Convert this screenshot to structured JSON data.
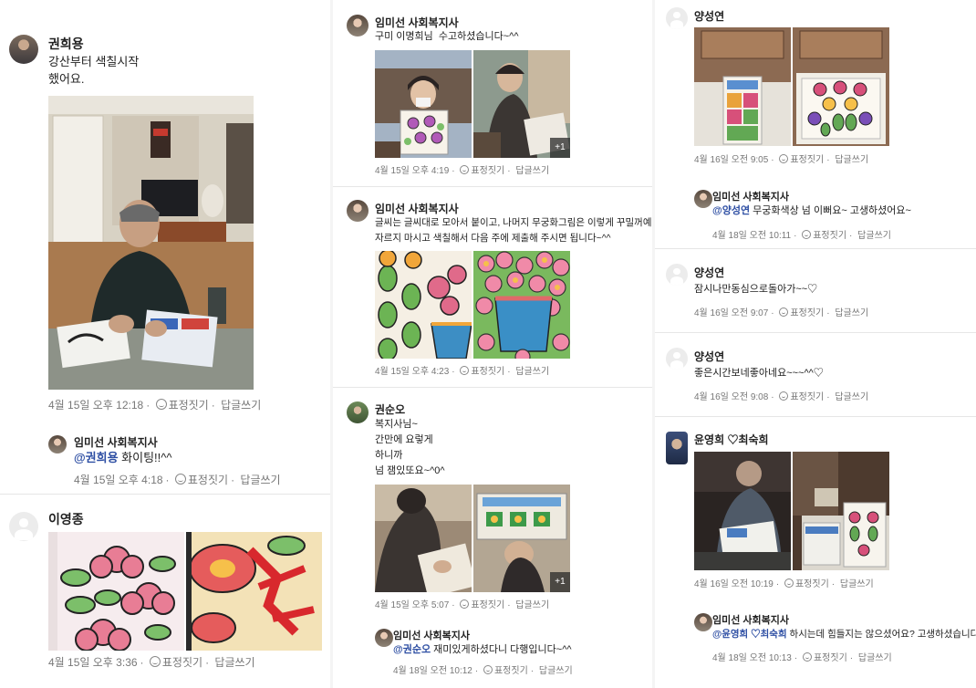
{
  "labels": {
    "react": "표정짓기",
    "reply": "답글쓰기",
    "more": "+1",
    "sep": "·"
  },
  "col1": {
    "post1": {
      "author": "권희용",
      "text": "강산부터 색칠시작\n했어요.",
      "time": "4월 15일 오후 12:18",
      "reply": {
        "author": "임미선 사회복지사",
        "mention": "@권희용",
        "text": " 화이팅!!^^",
        "time": "4월 15일 오후 4:18"
      }
    },
    "post2": {
      "author": "이영종",
      "time": "4월 15일 오후 3:36"
    }
  },
  "col2": {
    "post1": {
      "author": "임미선 사회복지사",
      "text": "구미 이명희님  수고하셨습니다~^^",
      "time": "4월 15일 오후 4:19"
    },
    "post2": {
      "author": "임미선 사회복지사",
      "text": "글씨는 글씨대로 모아서 붙이고, 나머지 무궁화그림은 이렇게 꾸밀꺼예요~\n자르지 마시고 색칠해서 다음 주에 제출해 주시면 됩니다~^^",
      "time": "4월 15일 오후 4:23"
    },
    "post3": {
      "author": "권순오",
      "text": "복지사님~\n간만에 요렇게\n하니까\n넘 잼있또요~^0^",
      "time": "4월 15일 오후 5:07",
      "reply": {
        "author": "임미선 사회복지사",
        "mention": "@권순오",
        "text": " 재미있게하셨다니 다행입니다~^^",
        "time": "4월 18일 오전 10:12"
      }
    }
  },
  "col3": {
    "post1": {
      "author": "양성연",
      "time": "4월 16일 오전 9:05",
      "reply": {
        "author": "임미선 사회복지사",
        "mention": "@양성연",
        "text": " 무궁화색상 넘 이뻐요~ 고생하셨어요~",
        "time": "4월 18일 오전 10:11"
      }
    },
    "post2": {
      "author": "양성연",
      "text": "잠시나만동심으로돌아가~~♡",
      "time": "4월 16일 오전 9:07"
    },
    "post3": {
      "author": "양성연",
      "text": "좋은시간보네좋아네요~~~^^♡",
      "time": "4월 16일 오전 9:08"
    },
    "post4": {
      "author": "윤영희 ♡최숙희",
      "time": "4월 16일 오전 10:19",
      "reply": {
        "author": "임미선 사회복지사",
        "mention": "@윤영희 ♡최숙희",
        "text": " 하시는데 힘들지는 않으셨어요? 고생하셨습니다^^",
        "time": "4월 18일 오전 10:13"
      }
    }
  }
}
